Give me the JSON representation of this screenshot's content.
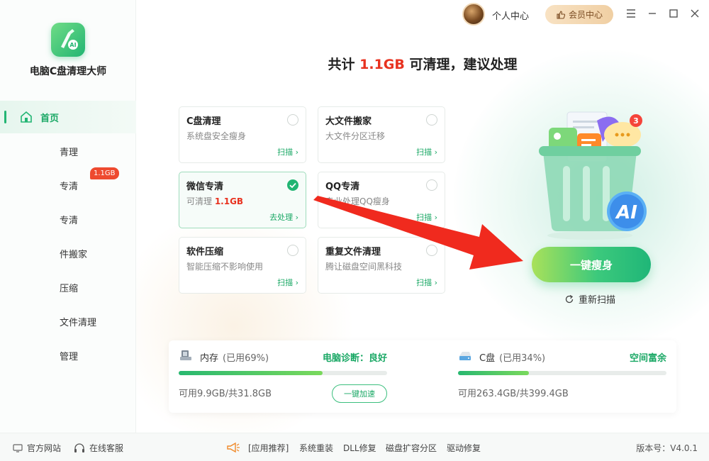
{
  "app": {
    "name": "电脑C盘清理大师"
  },
  "topbar": {
    "user_center": "个人中心",
    "vip_center": "会员中心"
  },
  "sidebar": {
    "items": [
      {
        "label": "首页",
        "active": true
      },
      {
        "label": "青理"
      },
      {
        "label": "专清",
        "badge": "1.1GB"
      },
      {
        "label": "专清"
      },
      {
        "label": "件搬家"
      },
      {
        "label": "压缩"
      },
      {
        "label": "文件清理"
      },
      {
        "label": "管理"
      }
    ]
  },
  "headline": {
    "prefix": "共计 ",
    "size": "1.1GB",
    "suffix": " 可清理，建议处理"
  },
  "cards": [
    {
      "title": "C盘清理",
      "desc": "系统盘安全瘦身",
      "action": "扫描 ›",
      "checked": false
    },
    {
      "title": "大文件搬家",
      "desc": "大文件分区迁移",
      "action": "扫描 ›",
      "checked": false
    },
    {
      "title": "微信专清",
      "desc_prefix": "可清理 ",
      "desc_value": "1.1GB",
      "action": "去处理 ›",
      "checked": true
    },
    {
      "title": "QQ专清",
      "desc": "专业处理QQ瘦身",
      "action": "扫描 ›",
      "checked": false
    },
    {
      "title": "软件压缩",
      "desc": "智能压缩不影响使用",
      "action": "扫描 ›",
      "checked": false
    },
    {
      "title": "重复文件清理",
      "desc": "腾让磁盘空间黑科技",
      "action": "扫描 ›",
      "checked": false
    }
  ],
  "illustration": {
    "notify_count": "3",
    "ai_label": "AI"
  },
  "main_action": {
    "button": "一键瘦身",
    "rescan": "重新扫描"
  },
  "memory": {
    "name": "内存",
    "used": "(已用69%)",
    "used_pct": 69,
    "status": "电脑诊断：良好",
    "detail": "可用9.9GB/共31.8GB",
    "speed_button": "一键加速"
  },
  "disk": {
    "name": "C盘",
    "used": "(已用34%)",
    "used_pct": 34,
    "status": "空间富余",
    "detail": "可用263.4GB/共399.4GB"
  },
  "footer": {
    "website": "官方网站",
    "support": "在线客服",
    "recommend": "[应用推荐]",
    "links": [
      "系统重装",
      "DLL修复",
      "磁盘扩容分区",
      "驱动修复"
    ],
    "version": "版本号：V4.0.1"
  },
  "colors": {
    "accent": "#22b573",
    "highlight": "#e8321f"
  }
}
